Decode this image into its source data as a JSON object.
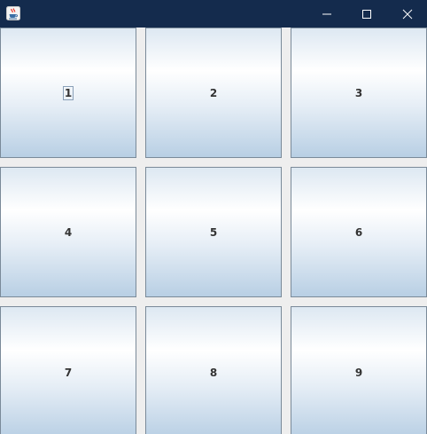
{
  "window": {
    "icon": "java-cup-icon",
    "controls": [
      "minimize-icon",
      "maximize-icon",
      "close-icon"
    ]
  },
  "grid": {
    "buttons": [
      {
        "label": "1",
        "focused": true
      },
      {
        "label": "2"
      },
      {
        "label": "3"
      },
      {
        "label": "4"
      },
      {
        "label": "5"
      },
      {
        "label": "6"
      },
      {
        "label": "7"
      },
      {
        "label": "8"
      },
      {
        "label": "9"
      }
    ]
  },
  "colors": {
    "titlebar": "#142b4d",
    "background": "#eeeeee",
    "button_border": "#7a8a99",
    "button_text": "#333333"
  }
}
